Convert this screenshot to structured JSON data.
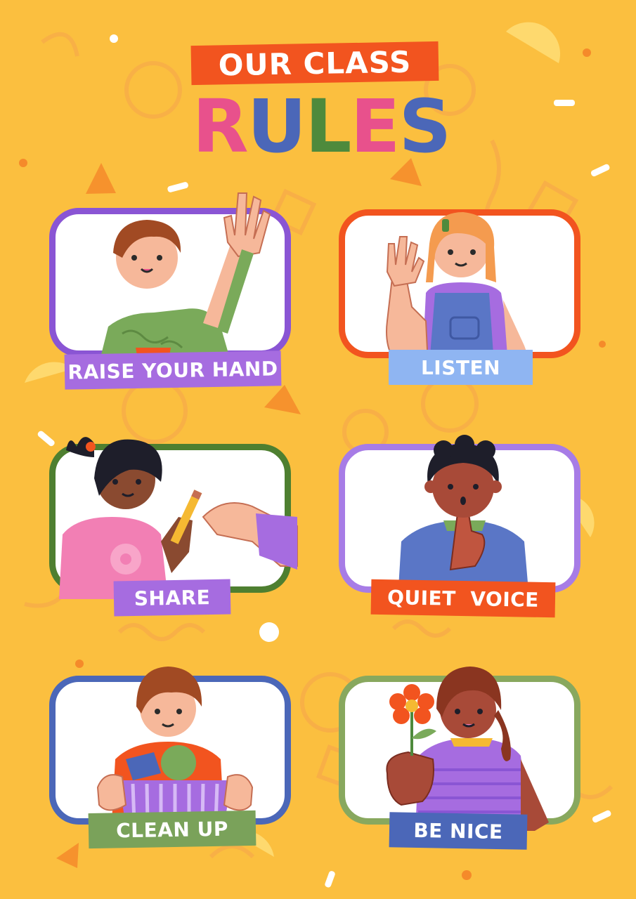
{
  "header": {
    "subtitle": "OUR CLASS",
    "title_letters": [
      {
        "char": "R",
        "color": "#e8518c"
      },
      {
        "char": "U",
        "color": "#4b67b8"
      },
      {
        "char": "L",
        "color": "#4e8a3c"
      },
      {
        "char": "E",
        "color": "#e8518c"
      },
      {
        "char": "S",
        "color": "#4b67b8"
      }
    ]
  },
  "rules": [
    {
      "label": "RAISE YOUR HAND",
      "border_color": "#8a55d4",
      "label_color": "#a66ce0",
      "illustration": "boy-raising-hand"
    },
    {
      "label": "LISTEN",
      "border_color": "#f2541f",
      "label_color": "#8fb5f2",
      "illustration": "girl-listening"
    },
    {
      "label": "SHARE",
      "border_color": "#4e7f30",
      "label_color": "#a66ce0",
      "illustration": "girl-sharing-pencil"
    },
    {
      "label": "QUIET  VOICE",
      "border_color": "#a77ce6",
      "label_color": "#f2541f",
      "illustration": "boy-shushing"
    },
    {
      "label": "CLEAN UP",
      "border_color": "#4b67b8",
      "label_color": "#7aa25a",
      "illustration": "boy-with-basket"
    },
    {
      "label": "BE NICE",
      "border_color": "#88a85e",
      "label_color": "#4b67b8",
      "illustration": "girl-with-flower"
    }
  ],
  "colors": {
    "background": "#fbbf3f",
    "header_banner": "#f2541f"
  }
}
